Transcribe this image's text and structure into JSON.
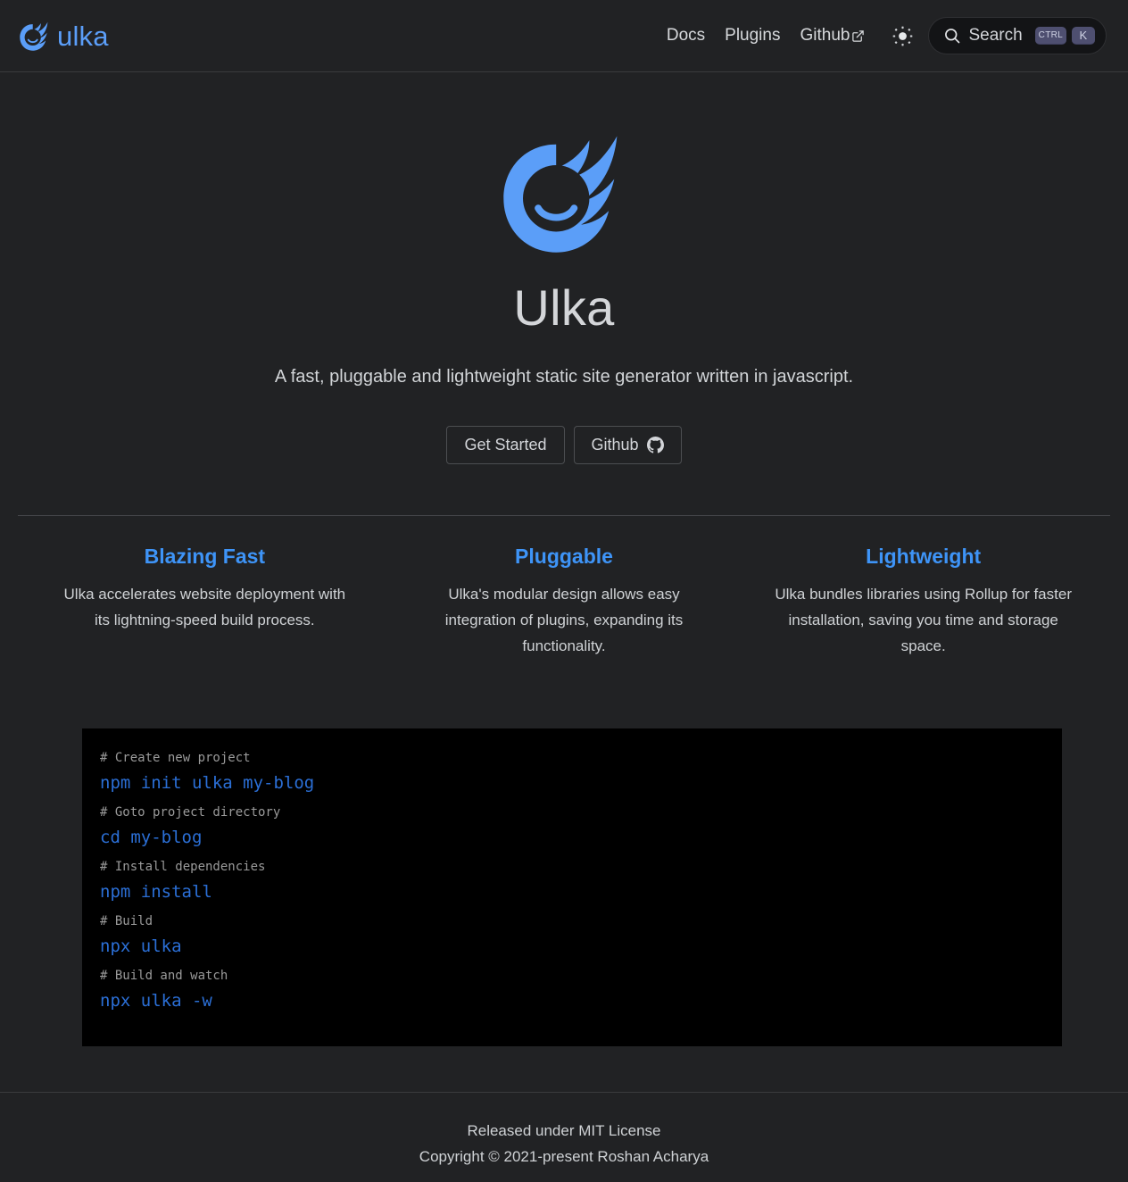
{
  "header": {
    "brand": {
      "name": "ulka",
      "logo_icon": "ulka-comet-logo",
      "color": "#5b9ef8"
    },
    "nav": [
      {
        "label": "Docs",
        "name": "nav-link-docs",
        "external": false
      },
      {
        "label": "Plugins",
        "name": "nav-link-plugins",
        "external": false
      },
      {
        "label": "Github",
        "name": "nav-link-github",
        "external": true,
        "icon": "external-link-icon"
      }
    ],
    "theme_toggle": {
      "icon": "sun-icon",
      "label": "Toggle theme"
    },
    "search": {
      "icon": "search-icon",
      "label": "Search",
      "placeholder": "Search",
      "shortcut_keys": [
        "CTRL",
        "K"
      ]
    }
  },
  "hero": {
    "logo_icon": "ulka-comet-logo",
    "title": "Ulka",
    "tagline": "A fast, pluggable and lightweight static site generator written in javascript.",
    "buttons": [
      {
        "label": "Get Started",
        "name": "get-started-button",
        "icon": null
      },
      {
        "label": "Github",
        "name": "hero-github-button",
        "icon": "github-mark-icon"
      }
    ]
  },
  "features": [
    {
      "title": "Blazing Fast",
      "text": "Ulka accelerates website deployment with its lightning-speed build process."
    },
    {
      "title": "Pluggable",
      "text": "Ulka's modular design allows easy integration of plugins, expanding its functionality."
    },
    {
      "title": "Lightweight",
      "text": "Ulka bundles libraries using Rollup for faster installation, saving you time and storage space."
    }
  ],
  "code_block": {
    "lines": [
      {
        "type": "comment",
        "text": "# Create new project"
      },
      {
        "type": "cmd",
        "text": "npm init ulka my-blog"
      },
      {
        "type": "comment",
        "text": "# Goto project directory"
      },
      {
        "type": "cmd",
        "text": "cd my-blog"
      },
      {
        "type": "comment",
        "text": "# Install dependencies"
      },
      {
        "type": "cmd",
        "text": "npm install"
      },
      {
        "type": "comment",
        "text": "# Build"
      },
      {
        "type": "cmd",
        "text": "npx ulka"
      },
      {
        "type": "comment",
        "text": "# Build and watch"
      },
      {
        "type": "cmd",
        "text": "npx ulka -w"
      }
    ]
  },
  "footer": {
    "license": "Released under MIT License",
    "copyright": "Copyright © 2021-present Roshan Acharya"
  },
  "colors": {
    "page_bg": "#212224",
    "accent_blue": "#3e94f7",
    "brand_blue": "#5b9ef8",
    "code_bg": "#000000",
    "code_cmd": "#2b6fd6",
    "code_comment": "#9a9a9a",
    "text": "#d3d5d9",
    "border": "#3a3b3d"
  }
}
